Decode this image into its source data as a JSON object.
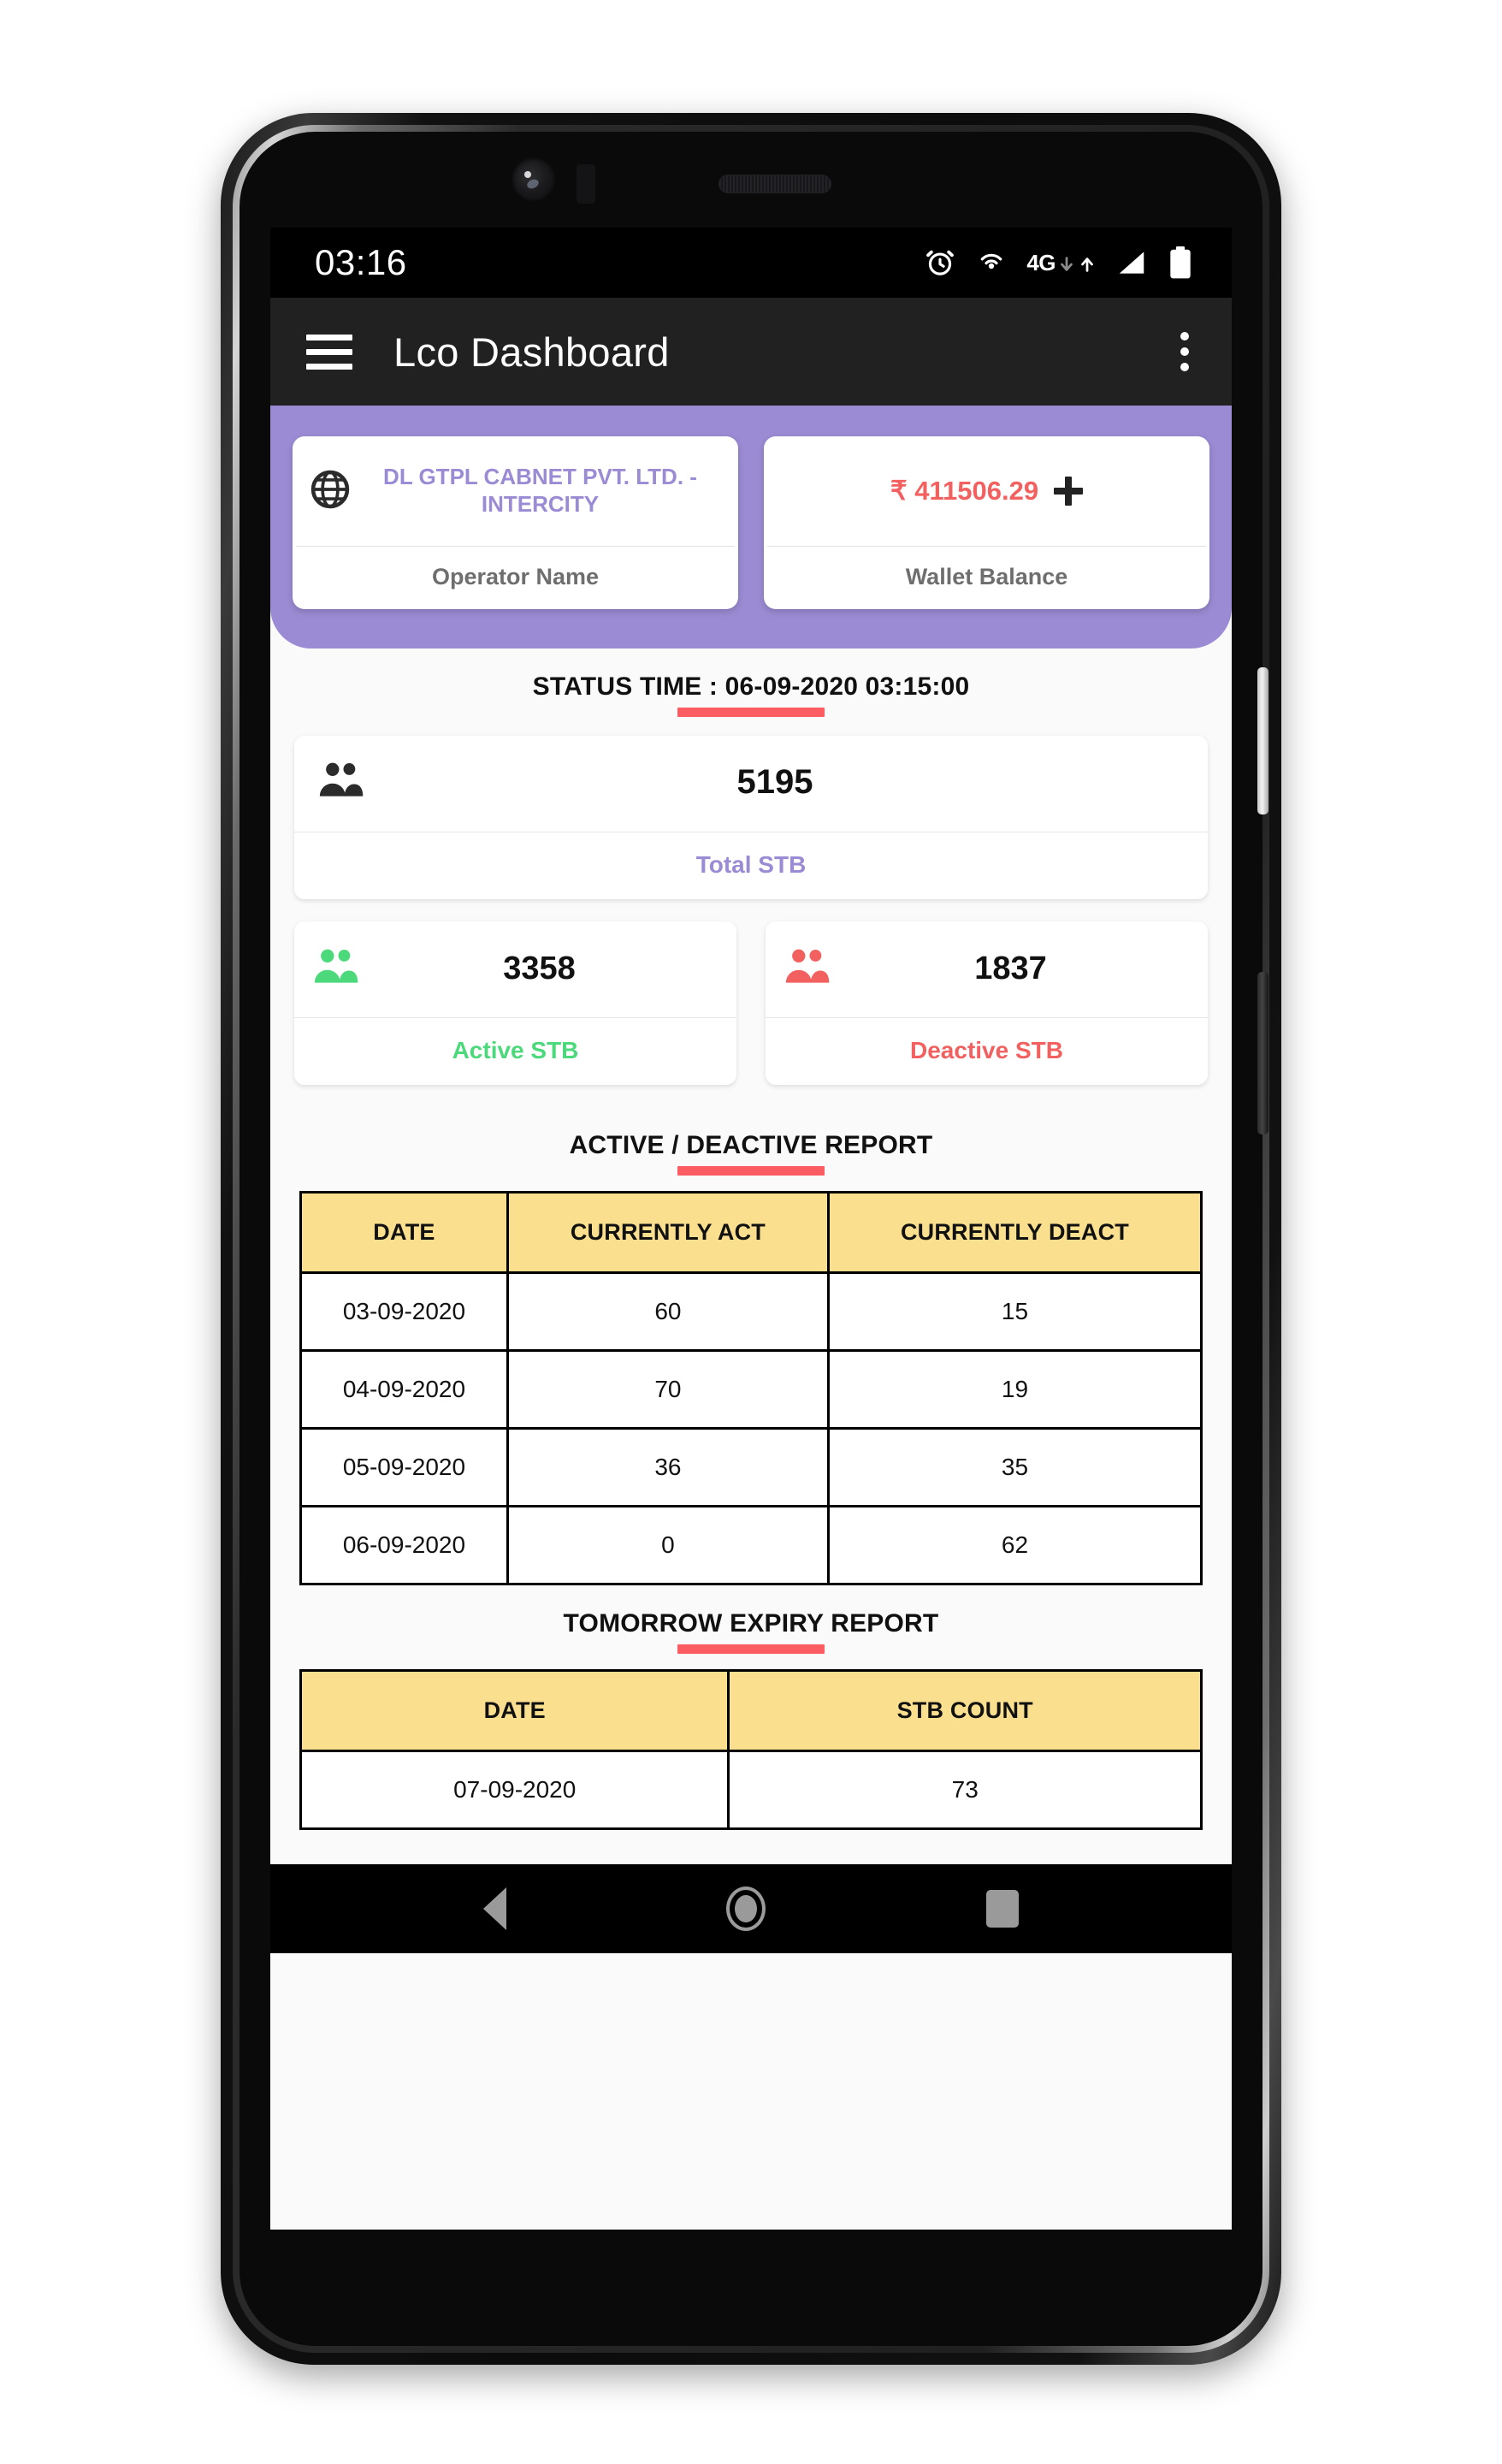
{
  "status_bar": {
    "time": "03:16",
    "network_label": "4G",
    "icons": [
      "alarm-icon",
      "hotspot-icon",
      "network-4g-icon",
      "signal-icon",
      "battery-icon"
    ]
  },
  "app_bar": {
    "menu_icon": "hamburger-menu-icon",
    "title": "Lco Dashboard",
    "overflow_icon": "kebab-menu-icon"
  },
  "header": {
    "operator_card": {
      "icon": "globe-icon",
      "value": "DL GTPL CABNET PVT. LTD. - INTERCITY",
      "label": "Operator Name"
    },
    "wallet_card": {
      "value": "₹ 411506.29",
      "add_icon": "plus-icon",
      "label": "Wallet Balance"
    },
    "accent_color": "#9b8bd4"
  },
  "status_time": {
    "text": "STATUS TIME : 06-09-2020 03:15:00",
    "underline_color": "#fb5d62"
  },
  "stats": {
    "total": {
      "icon": "people-icon",
      "value": "5195",
      "label": "Total STB",
      "color": "#9b8bd4"
    },
    "active": {
      "icon": "people-icon",
      "value": "3358",
      "label": "Active STB",
      "color": "#4cd97b"
    },
    "deactive": {
      "icon": "people-icon",
      "value": "1837",
      "label": "Deactive STB",
      "color": "#f2615f"
    }
  },
  "active_deactive_report": {
    "title": "ACTIVE / DEACTIVE REPORT",
    "columns": [
      "DATE",
      "CURRENTLY ACT",
      "CURRENTLY DEACT"
    ],
    "rows": [
      [
        "03-09-2020",
        "60",
        "15"
      ],
      [
        "04-09-2020",
        "70",
        "19"
      ],
      [
        "05-09-2020",
        "36",
        "35"
      ],
      [
        "06-09-2020",
        "0",
        "62"
      ]
    ]
  },
  "tomorrow_expiry_report": {
    "title": "TOMORROW EXPIRY REPORT",
    "columns": [
      "DATE",
      "STB COUNT"
    ],
    "rows": [
      [
        "07-09-2020",
        "73"
      ]
    ]
  },
  "nav_bar": {
    "back": "back-nav-icon",
    "home": "home-nav-icon",
    "recents": "recents-nav-icon"
  },
  "theme": {
    "header_purple": "#9b8bd4",
    "table_header_yellow": "#fadf8e",
    "accent_red": "#fb5d62",
    "green": "#4cd97b",
    "red": "#f2615f"
  }
}
